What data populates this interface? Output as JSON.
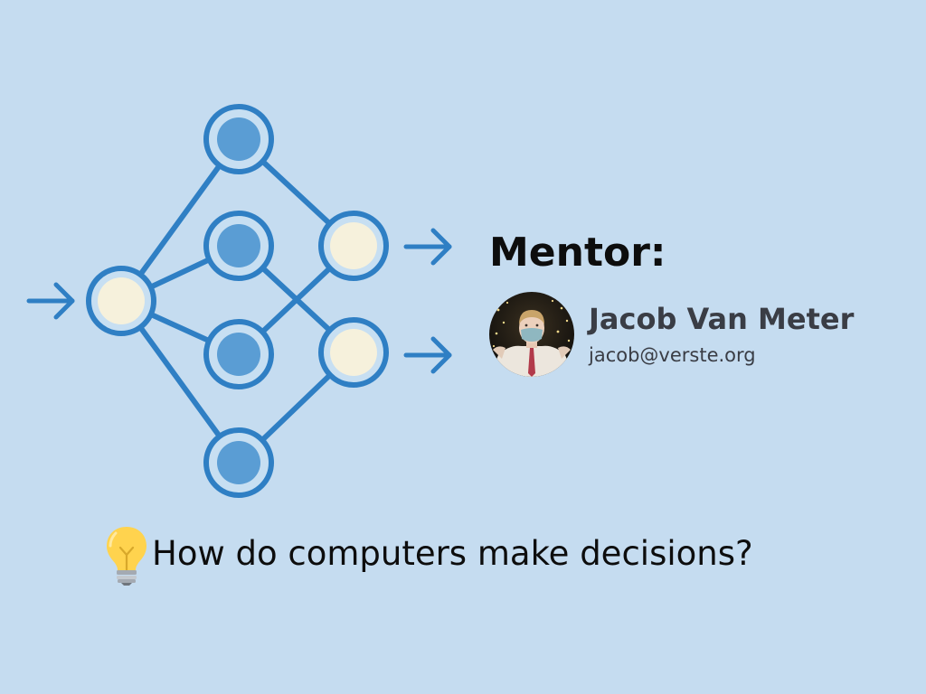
{
  "mentor": {
    "heading": "Mentor:",
    "name": "Jacob Van Meter",
    "email": "jacob@verste.org"
  },
  "question": {
    "text": "How do computers make decisions?",
    "icon": "lightbulb-icon"
  },
  "diagram": {
    "icon": "neural-network-icon",
    "colors": {
      "stroke": "#2f7fc4",
      "hidden_fill": "#5a9dd4",
      "hidden_ring": "#c7dff2",
      "io_fill": "#f6f1dc"
    }
  },
  "colors": {
    "background": "#c5dcf0",
    "heading": "#0d0d0d",
    "name": "#3a3d45"
  }
}
